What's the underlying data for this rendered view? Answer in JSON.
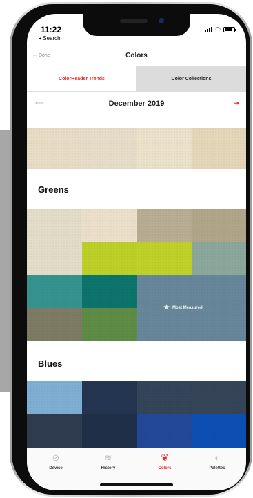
{
  "status": {
    "time": "11:22",
    "back_label": "◂ Search"
  },
  "navbar": {
    "back_label": "← Done",
    "title": "Colors"
  },
  "tabs": [
    {
      "label": "ColorReader Trends"
    },
    {
      "label": "Color Collections"
    }
  ],
  "month": {
    "label": "December 2019",
    "prev_icon": "arrow-left-icon",
    "next_icon": "arrow-right-icon"
  },
  "sections": [
    {
      "title": "Greens"
    },
    {
      "title": "Blues"
    }
  ],
  "featured": {
    "label": "Most Measured",
    "icon": "star-icon"
  },
  "colors": {
    "accent": "#e32a2a",
    "cream": [
      "#e8dcc4",
      "#e6dcc8",
      "#ece1cb",
      "#e4d6b8"
    ],
    "greens_row1": [
      "#e3dcc9",
      "#ebdfc9",
      "#b8ad92",
      "#b0a589"
    ],
    "greens_row2": [
      "#e3dcc9",
      "#bdd028",
      "#bfd028",
      "#8ba79b"
    ],
    "greens_row3": [
      "#35938f",
      "#0c746a",
      "#67869a"
    ],
    "greens_row4": [
      "#7e7b64",
      "#5e8c46"
    ],
    "blues_row1": [
      "#7faed3",
      "#233551",
      "#344459",
      "#354456"
    ],
    "blues_row2": [
      "#2f3c50",
      "#1f2f48",
      "#234898",
      "#0d4eb2"
    ]
  },
  "tabbar": [
    {
      "label": "Device",
      "icon": "device-icon"
    },
    {
      "label": "History",
      "icon": "history-icon"
    },
    {
      "label": "Colors",
      "icon": "colors-icon"
    },
    {
      "label": "Palettes",
      "icon": "palettes-icon"
    }
  ]
}
